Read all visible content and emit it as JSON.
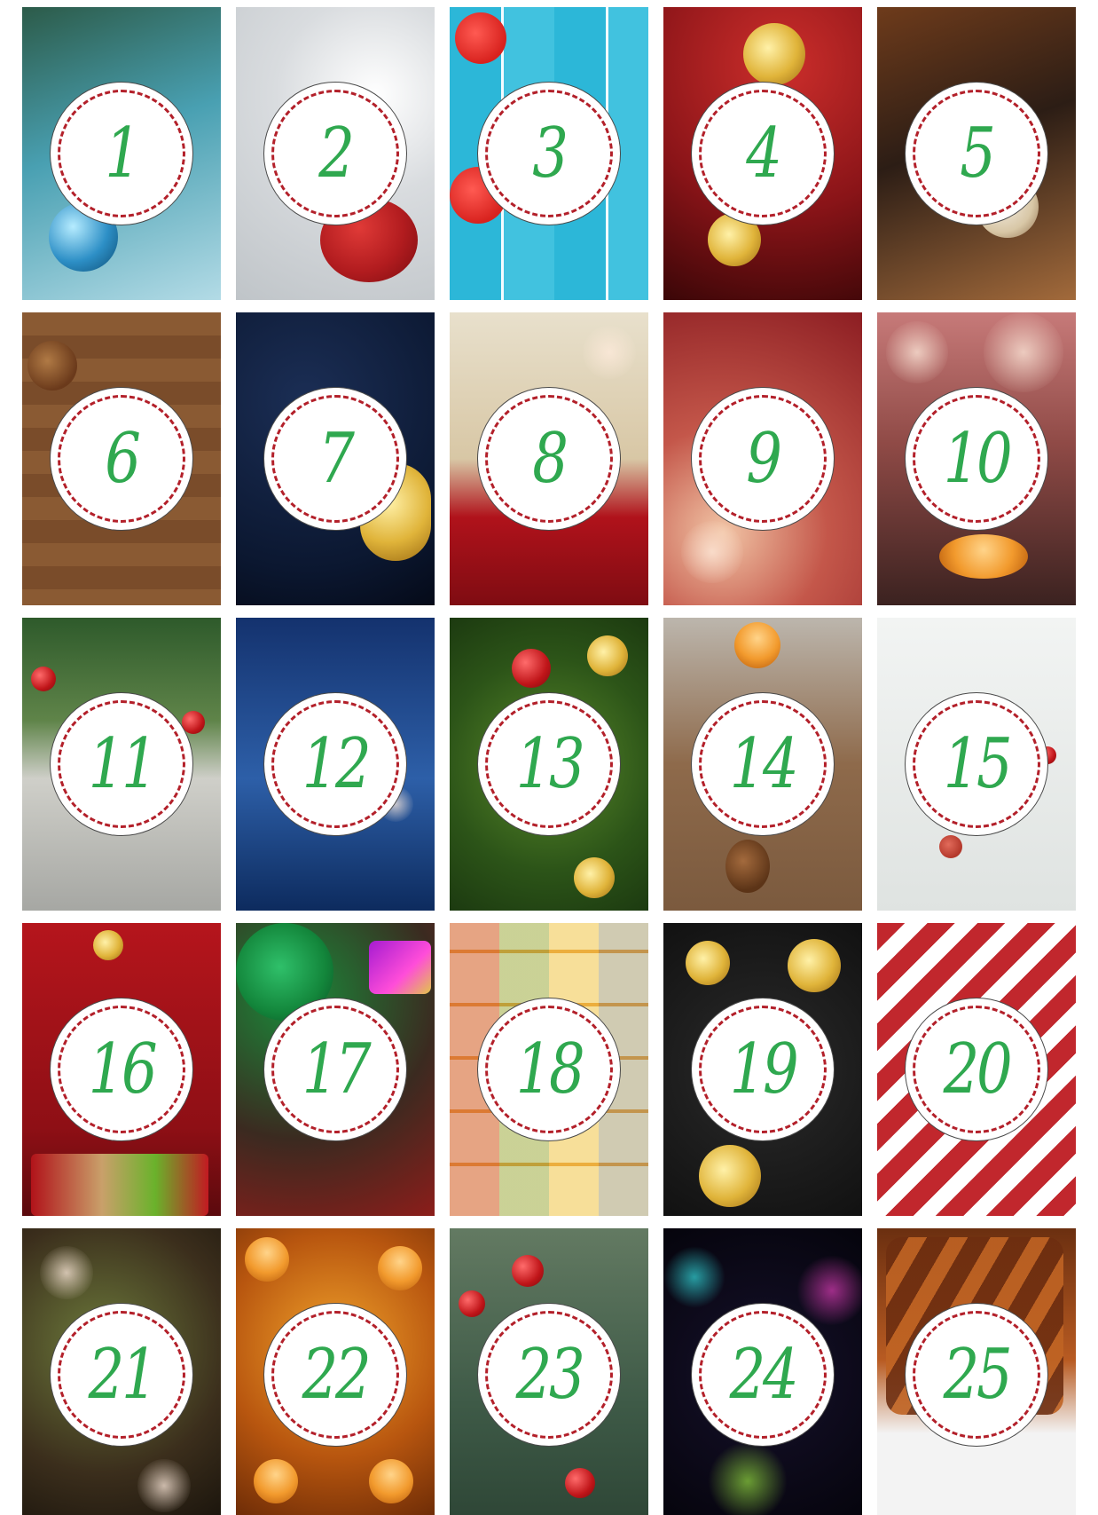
{
  "calendar": {
    "days": [
      {
        "number": "1",
        "theme": "blue-ornament"
      },
      {
        "number": "2",
        "theme": "santa-sack"
      },
      {
        "number": "3",
        "theme": "hearts-on-wood"
      },
      {
        "number": "4",
        "theme": "red-gold-snowflakes"
      },
      {
        "number": "5",
        "theme": "cinnamon-cookies"
      },
      {
        "number": "6",
        "theme": "pinecone-wood"
      },
      {
        "number": "7",
        "theme": "gold-baubles-night"
      },
      {
        "number": "8",
        "theme": "poinsettia"
      },
      {
        "number": "9",
        "theme": "red-gold-bokeh"
      },
      {
        "number": "10",
        "theme": "tealight-candle"
      },
      {
        "number": "11",
        "theme": "fir-branches"
      },
      {
        "number": "12",
        "theme": "snowy-night"
      },
      {
        "number": "13",
        "theme": "tree-baubles"
      },
      {
        "number": "14",
        "theme": "spices-oranges"
      },
      {
        "number": "15",
        "theme": "white-gifts"
      },
      {
        "number": "16",
        "theme": "christmas-tree-gifts"
      },
      {
        "number": "17",
        "theme": "green-bauble-presents"
      },
      {
        "number": "18",
        "theme": "pattern-tiles"
      },
      {
        "number": "19",
        "theme": "gold-pattern"
      },
      {
        "number": "20",
        "theme": "candy-stripes"
      },
      {
        "number": "21",
        "theme": "lights-tree"
      },
      {
        "number": "22",
        "theme": "many-candles"
      },
      {
        "number": "23",
        "theme": "holly-berries"
      },
      {
        "number": "24",
        "theme": "neon-snowflakes"
      },
      {
        "number": "25",
        "theme": "cinnamon-sticks"
      }
    ]
  },
  "colors": {
    "number_color": "#2fa84f",
    "ring_color": "#b3202a"
  }
}
